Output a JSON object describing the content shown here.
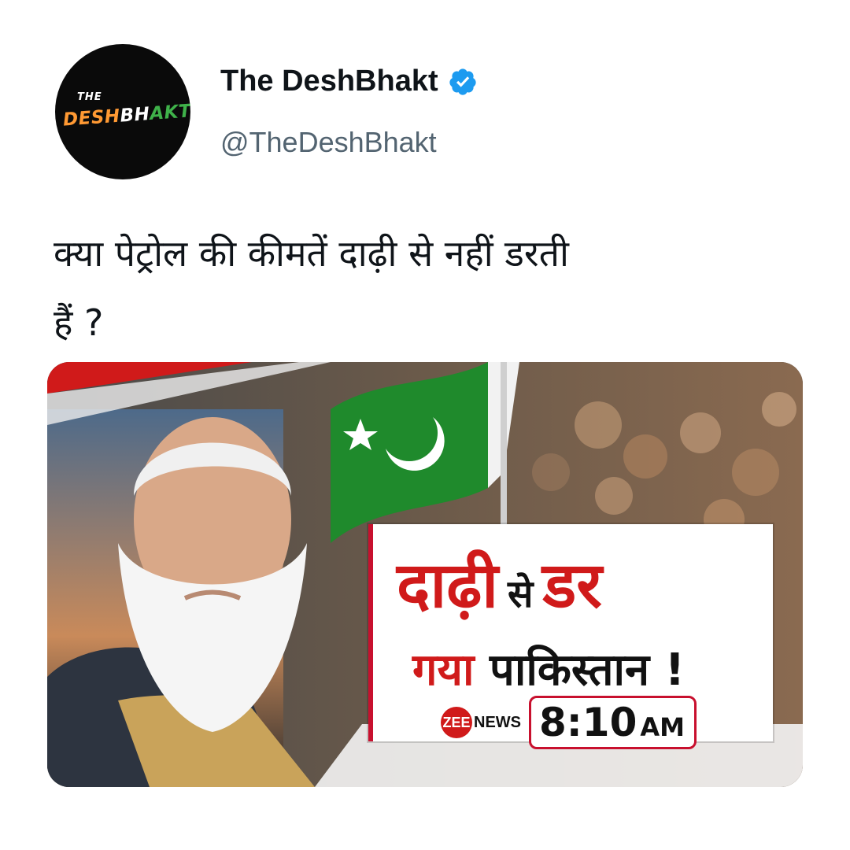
{
  "account": {
    "display_name": "The DeshBhakt",
    "handle": "@TheDeshBhakt",
    "verified": true,
    "avatar_logo": {
      "line1": "THE",
      "line2": "DESHBHAKT"
    },
    "verified_color": "#1d9bf0"
  },
  "tweet": {
    "text_line1": "क्या पेट्रोल की कीमतें दाढ़ी से नहीं डरती",
    "text_line2": "हैं ?"
  },
  "media": {
    "headline_word1": "दाढ़ी",
    "headline_word2": "से",
    "headline_word3": "डर",
    "headline_line2_a": "गया",
    "headline_line2_b": "पाकिस्तान",
    "headline_line2_c": "!",
    "channel_zee": "ZEE",
    "channel_news": "NEWS",
    "time": "8:10",
    "ampm": "AM",
    "accent_red": "#d01a1a",
    "flag_green": "#1f8a2c"
  }
}
